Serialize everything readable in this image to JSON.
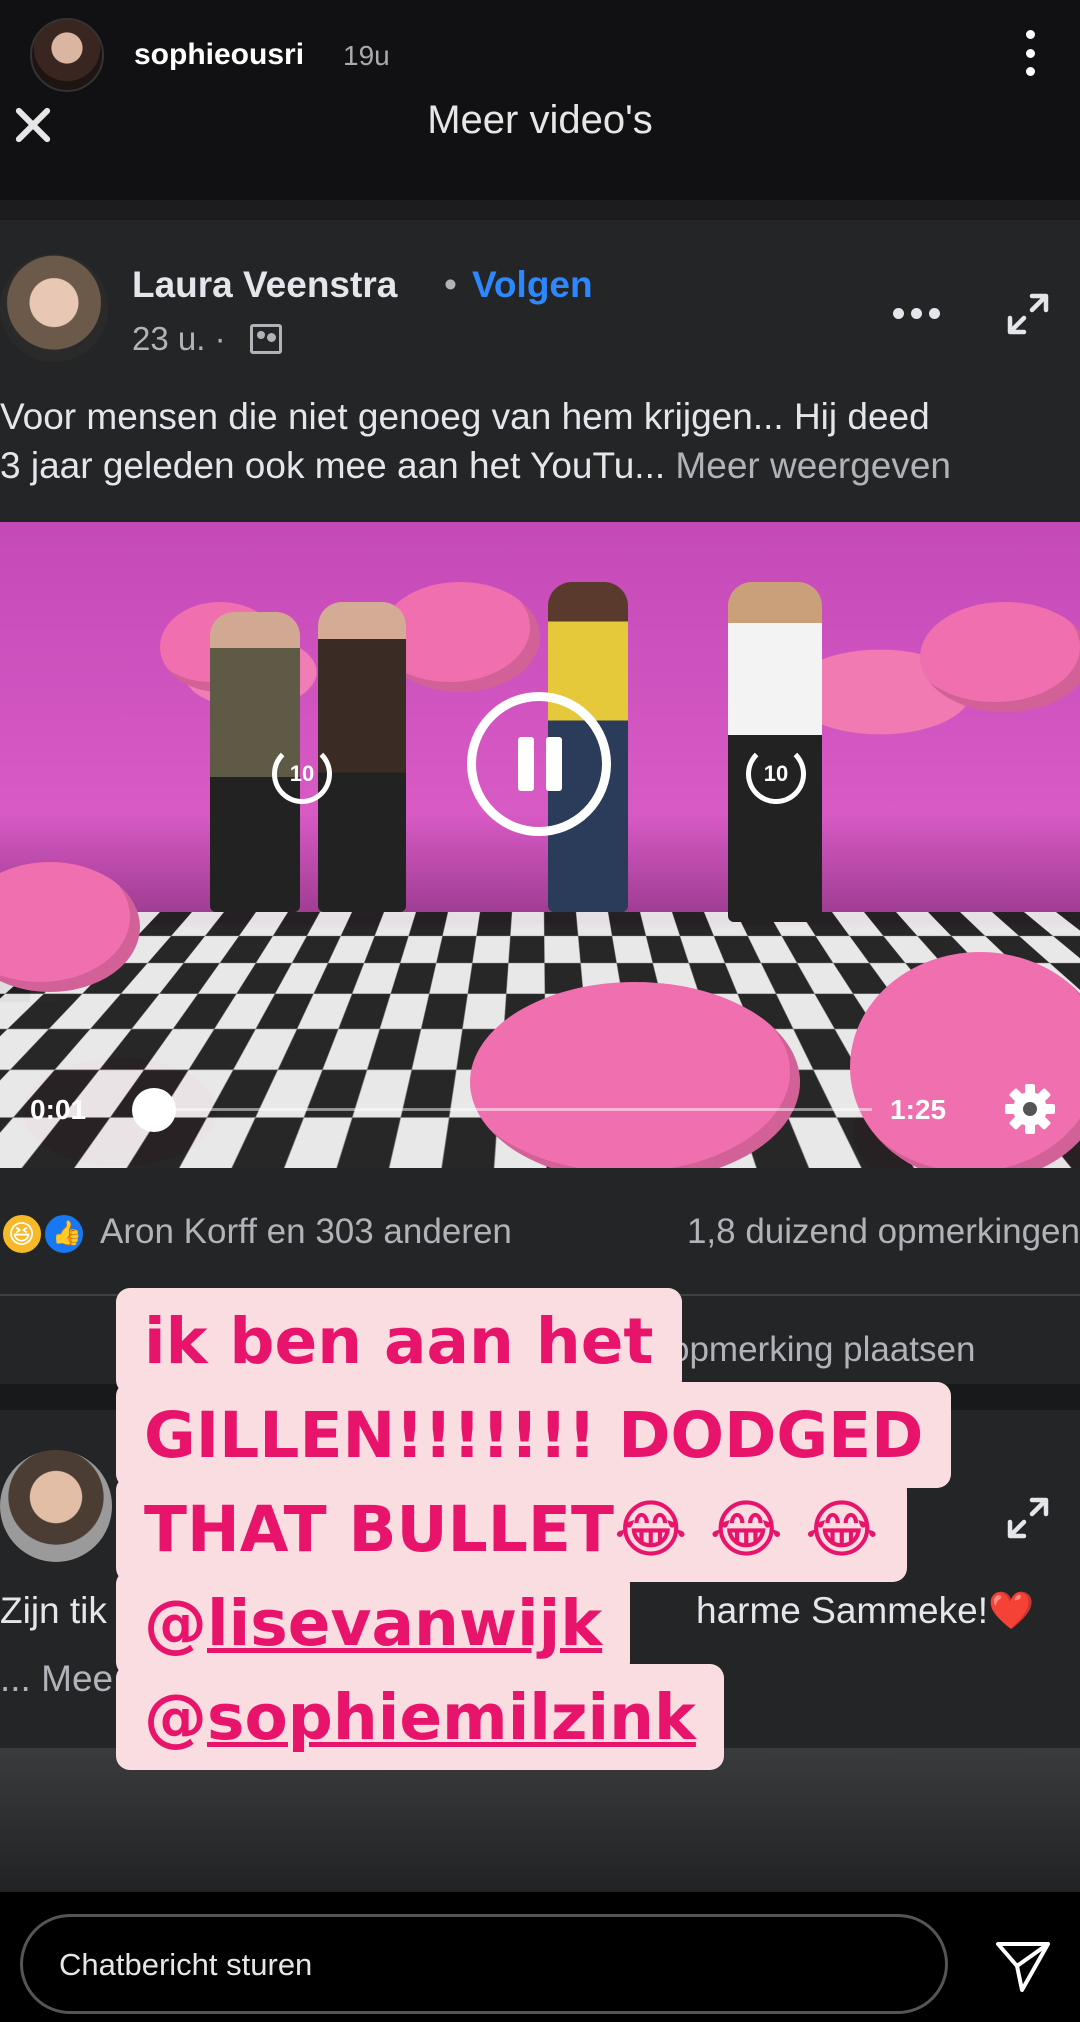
{
  "story": {
    "username": "sophieousri",
    "time_ago": "19u",
    "title": "Meer video's"
  },
  "post": {
    "author": "Laura Veenstra",
    "separator": "•",
    "follow_label": "Volgen",
    "time": "23 u. ·",
    "text_line1": "Voor mensen die niet genoeg van hem krijgen... Hij deed",
    "text_line2": "3 jaar geleden ook mee aan het YouTu...",
    "more_label": "Meer weergeven",
    "video": {
      "skip_back": "10",
      "skip_forward": "10",
      "current_time": "0:01",
      "total_time": "1:25",
      "progress": 0.012
    },
    "reactors": "Aron Korff en 303 anderen",
    "comment_count": "1,8 duizend opmerkingen",
    "comment_action": "opmerking plaatsen"
  },
  "post2": {
    "text_left": "Zijn tik",
    "text_right": "harme Sammeke!❤️",
    "more_left": "... Mee"
  },
  "sticker": {
    "line1": "ik ben aan het",
    "line2": "GILLEN!!!!!!! DODGED",
    "line3": "THAT BULLET😂 😂 😂",
    "line4_at": "@",
    "line4_user": "lisevanwijk",
    "line5_at": "@",
    "line5_user": "sophiemilzink"
  },
  "chat": {
    "placeholder": "Chatbericht sturen"
  },
  "icons": {
    "close": "close-icon",
    "more": "more-options-icon",
    "expand": "expand-icon",
    "settings": "gear-icon",
    "send": "send-icon"
  },
  "colors": {
    "follow": "#2d88ff",
    "sticker_text": "#e8146c",
    "sticker_bg": "#f9dde1"
  }
}
